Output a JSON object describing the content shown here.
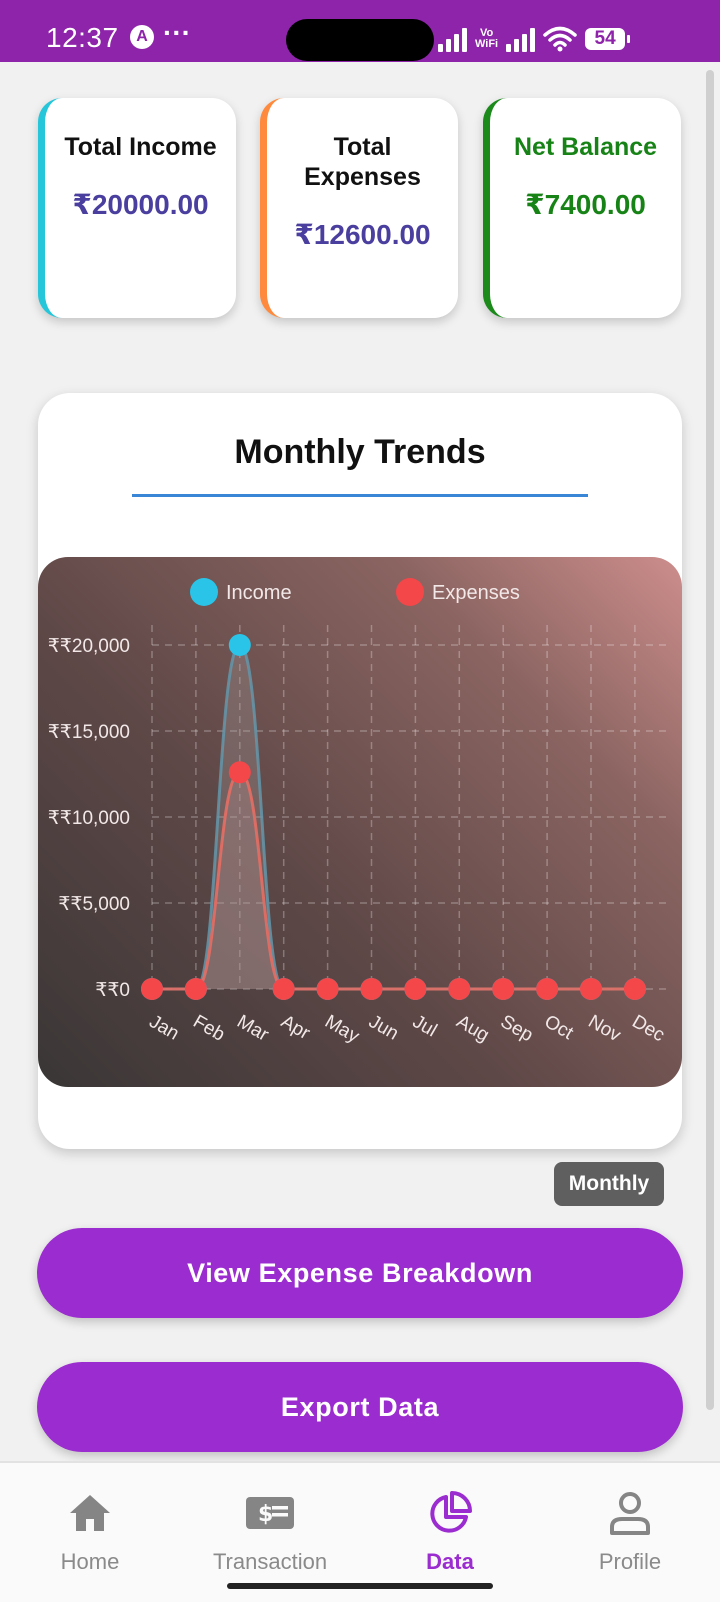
{
  "status_bar": {
    "time": "12:37",
    "app_icon_letter": "A",
    "overflow": "···",
    "vowifi": "Vo\nWiFi",
    "battery": "54"
  },
  "summary": {
    "income": {
      "label": "Total Income",
      "value": "₹20000.00"
    },
    "expenses": {
      "label": "Total Expenses",
      "value": "₹12600.00"
    },
    "balance": {
      "label": "Net Balance",
      "value": "₹7400.00"
    }
  },
  "chart_card": {
    "title": "Monthly Trends"
  },
  "chart_data": {
    "type": "line",
    "title": "Monthly Trends",
    "categories": [
      "Jan",
      "Feb",
      "Mar",
      "Apr",
      "May",
      "Jun",
      "Jul",
      "Aug",
      "Sep",
      "Oct",
      "Nov",
      "Dec"
    ],
    "series": [
      {
        "name": "Income",
        "color": "#29c4e8",
        "values": [
          0,
          0,
          20000,
          0,
          0,
          0,
          0,
          0,
          0,
          0,
          0,
          0
        ]
      },
      {
        "name": "Expenses",
        "color": "#f4474a",
        "values": [
          0,
          0,
          12600,
          0,
          0,
          0,
          0,
          0,
          0,
          0,
          0,
          0
        ]
      }
    ],
    "y_ticks": [
      0,
      5000,
      10000,
      15000,
      20000
    ],
    "y_tick_labels": [
      "₹₹0",
      "₹₹5,000",
      "₹₹10,000",
      "₹₹15,000",
      "₹₹20,000"
    ],
    "ylim": [
      0,
      20000
    ],
    "legend_position": "top",
    "grid": true
  },
  "period_badge": "Monthly",
  "buttons": {
    "breakdown": "View Expense Breakdown",
    "export": "Export Data"
  },
  "nav": {
    "active": "Data",
    "items": [
      {
        "label": "Home",
        "icon": "home-icon"
      },
      {
        "label": "Transaction",
        "icon": "transaction-icon"
      },
      {
        "label": "Data",
        "icon": "pie-chart-icon"
      },
      {
        "label": "Profile",
        "icon": "profile-icon"
      }
    ]
  }
}
